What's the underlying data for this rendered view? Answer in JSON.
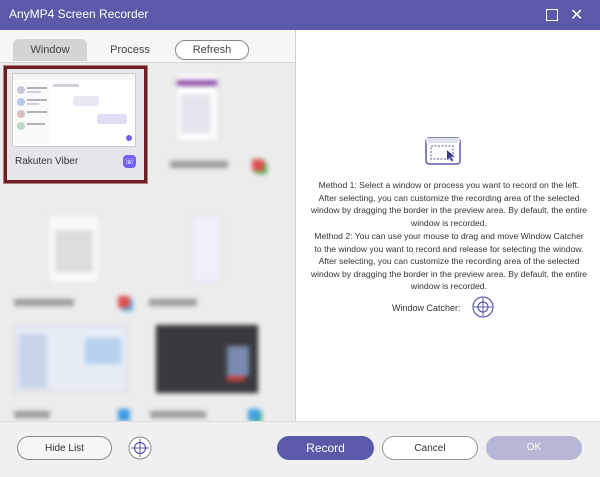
{
  "titlebar": {
    "title": "AnyMP4 Screen Recorder",
    "maximize_icon": "maximize-icon",
    "close_icon": "close-icon"
  },
  "tabs": {
    "window": "Window",
    "process": "Process",
    "refresh": "Refresh"
  },
  "selected_window": {
    "label": "Rakuten Viber",
    "app_icon": "viber-icon"
  },
  "instructions": {
    "method1": "Method 1: Select a window or process you want to record on the left. After selecting, you can customize the recording area of the selected window by dragging the border in the preview area. By default, the entire window is recorded.",
    "method2": "Method 2: You can use your mouse to drag and move Window Catcher to the window you want to record and release for selecting the window. After selecting, you can customize the recording area of the selected window by dragging the border in the preview area. By default, the entire window is recorded.",
    "catcher_label": "Window Catcher:"
  },
  "buttons": {
    "hide_list": "Hide List",
    "record": "Record",
    "cancel": "Cancel",
    "ok": "OK"
  },
  "colors": {
    "accent": "#5a5aa8",
    "selection_border": "#6e1d22"
  }
}
